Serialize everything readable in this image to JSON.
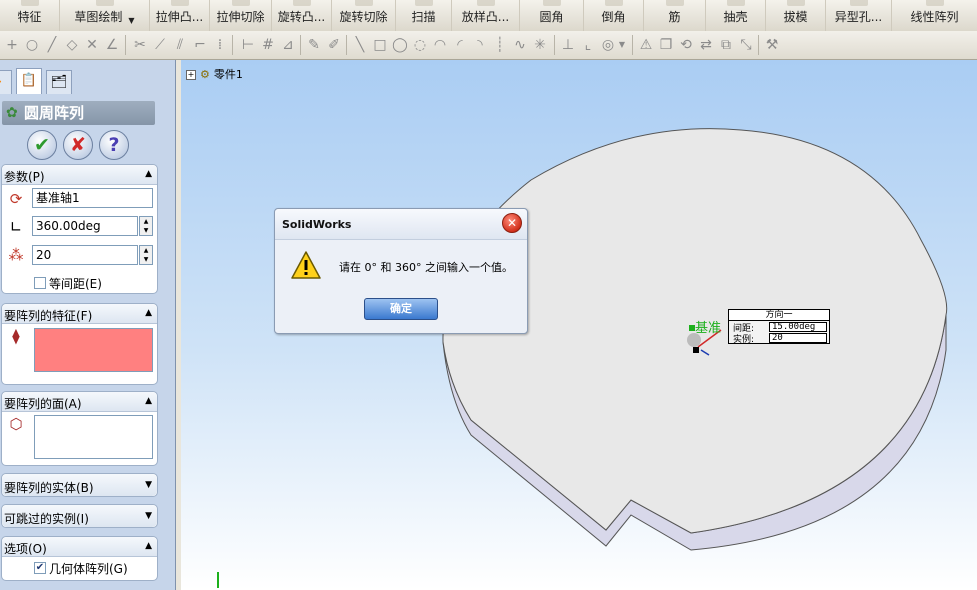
{
  "command_manager": {
    "items": [
      {
        "label": "特征",
        "has_dropdown": false
      },
      {
        "label": "草图绘制",
        "has_dropdown": true
      },
      {
        "label": "拉伸凸...",
        "has_dropdown": false
      },
      {
        "label": "拉伸切除",
        "has_dropdown": false
      },
      {
        "label": "旋转凸...",
        "has_dropdown": false
      },
      {
        "label": "旋转切除",
        "has_dropdown": false
      },
      {
        "label": "扫描",
        "has_dropdown": false
      },
      {
        "label": "放样凸...",
        "has_dropdown": false
      },
      {
        "label": "圆角",
        "has_dropdown": false
      },
      {
        "label": "倒角",
        "has_dropdown": false
      },
      {
        "label": "筋",
        "has_dropdown": false
      },
      {
        "label": "抽壳",
        "has_dropdown": false
      },
      {
        "label": "拔模",
        "has_dropdown": false
      },
      {
        "label": "异型孔...",
        "has_dropdown": false
      },
      {
        "label": "线性阵列",
        "has_dropdown": false
      }
    ]
  },
  "property_manager": {
    "title": "圆周阵列",
    "parameters": {
      "header": "参数(P)",
      "axis_value": "基准轴1",
      "angle_value": "360.00deg",
      "instances_value": "20",
      "equal_spacing_label": "等间距(E)",
      "equal_spacing_checked": false
    },
    "features_group": {
      "header": "要阵列的特征(F)",
      "selection_color": "#ff8080"
    },
    "faces_group": {
      "header": "要阵列的面(A)"
    },
    "bodies_group": {
      "header": "要阵列的实体(B)"
    },
    "skip_group": {
      "header": "可跳过的实例(I)"
    },
    "options_group": {
      "header": "选项(O)",
      "geometry_pattern_label": "几何体阵列(G)",
      "geometry_pattern_checked": true
    }
  },
  "tree": {
    "root": "零件1"
  },
  "dialog": {
    "title": "SolidWorks",
    "message": "请在 0° 和 360° 之间输入一个值。",
    "ok_label": "确定"
  },
  "callout": {
    "header": "方向一",
    "spacing_label": "间距:",
    "spacing_value": "15.00deg",
    "instances_label": "实例:",
    "instances_value": "20",
    "axis_label": "基准"
  }
}
